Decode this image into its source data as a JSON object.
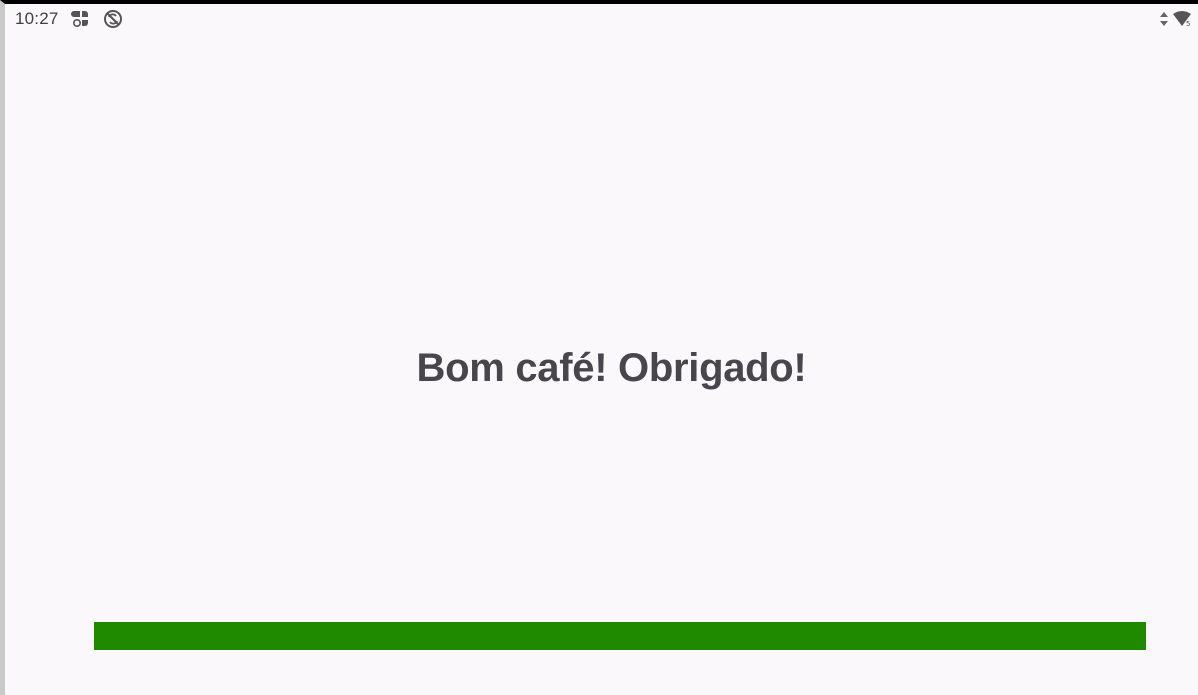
{
  "status_bar": {
    "time": "10:27",
    "icons": [
      "app-grid-icon",
      "no-sync-icon"
    ],
    "right_icons": [
      "data-arrows-icon",
      "wifi-icon"
    ]
  },
  "main": {
    "message": "Bom café! Obrigado!"
  },
  "progress": {
    "value": 1.0,
    "color": "#1f8a00"
  },
  "colors": {
    "background": "#fbf8fb",
    "text": "#48464d",
    "accent": "#1f8a00"
  }
}
